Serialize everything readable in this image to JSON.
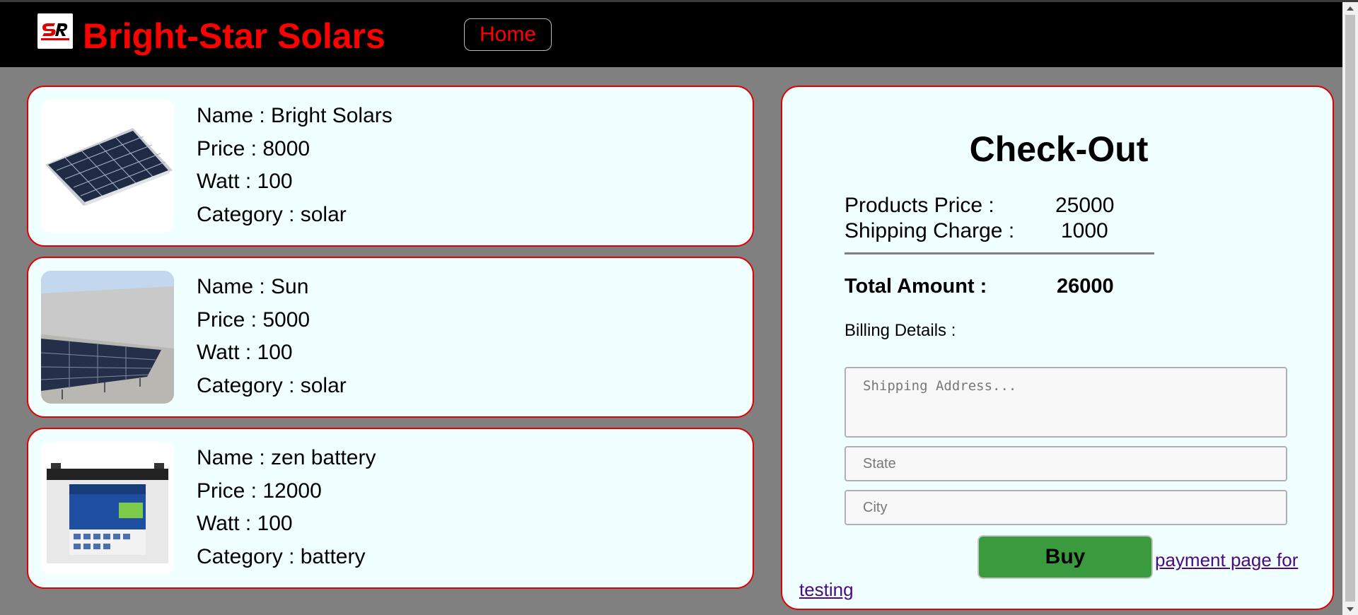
{
  "header": {
    "brand": "Bright-Star Solars",
    "logo_text": "SR",
    "nav": {
      "home_label": "Home"
    }
  },
  "products": [
    {
      "name": "Name : Bright Solars",
      "price": "Price : 8000",
      "watt": "Watt : 100",
      "category": "Category : solar",
      "image_icon": "solar-panel-image"
    },
    {
      "name": "Name : Sun",
      "price": "Price : 5000",
      "watt": "Watt : 100",
      "category": "Category : solar",
      "image_icon": "rooftop-solar-image"
    },
    {
      "name": "Name : zen battery",
      "price": "Price : 12000",
      "watt": "Watt : 100",
      "category": "Category : battery",
      "image_icon": "battery-image"
    }
  ],
  "checkout": {
    "title": "Check-Out",
    "products_price_label": "Products Price :",
    "products_price_value": "25000",
    "shipping_label": "Shipping Charge :",
    "shipping_value": "1000",
    "total_label": "Total Amount :",
    "total_value": "26000",
    "billing_label": "Billing Details :",
    "address_placeholder": "Shipping Address...",
    "state_placeholder": "State",
    "city_placeholder": "City",
    "buy_label": "Buy",
    "payment_link_part1": "payment page for",
    "payment_link_part2": "testing"
  },
  "colors": {
    "brand": "#ff0000",
    "card_bg": "#f0ffff",
    "card_border": "#e00000",
    "page_bg": "#808080",
    "buy_button": "#3a9b3e",
    "link": "#4b0a82"
  }
}
